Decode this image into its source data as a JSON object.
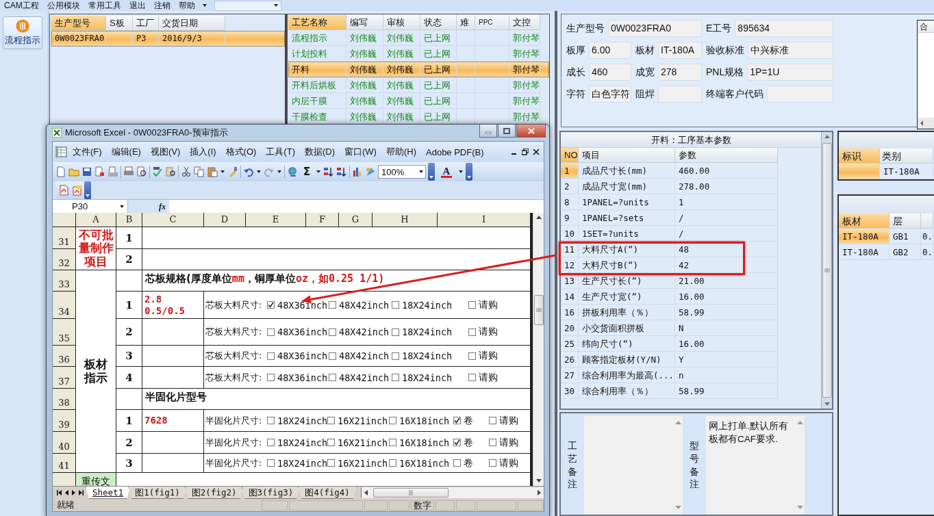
{
  "menu": [
    {
      "label": "CAM工程"
    },
    {
      "label": "公用模块"
    },
    {
      "label": "常用工具"
    },
    {
      "label": "退出"
    },
    {
      "label": "注销"
    },
    {
      "label": "帮助"
    }
  ],
  "sidebar": {
    "button": "流程指示"
  },
  "orders": {
    "columns": [
      {
        "label": "生产型号",
        "selected": true
      },
      {
        "label": "S板",
        "selected": false
      },
      {
        "label": "工厂",
        "selected": false
      },
      {
        "label": "交货日期",
        "selected": false
      }
    ],
    "rows": [
      {
        "model": "0W0023FRA0",
        "factory": "P3",
        "due": "2016/9/3",
        "selected": true
      }
    ]
  },
  "process": {
    "columns": [
      {
        "label": "工艺名称",
        "selected": true
      },
      {
        "label": "编写",
        "selected": false
      },
      {
        "label": "审核",
        "selected": false
      },
      {
        "label": "状态",
        "selected": false
      },
      {
        "label": "难",
        "selected": false
      },
      {
        "label": "PPC",
        "selected": false
      },
      {
        "label": "文控",
        "selected": false
      }
    ],
    "rows": [
      {
        "name": "流程指示",
        "writer": "刘伟巍",
        "reviewer": "刘伟巍",
        "status": "已上网",
        "control": "郭付琴",
        "selected": false
      },
      {
        "name": "计划投料",
        "writer": "刘伟巍",
        "reviewer": "刘伟巍",
        "status": "已上网",
        "control": "郭付琴",
        "selected": false
      },
      {
        "name": "开料",
        "writer": "刘伟巍",
        "reviewer": "刘伟巍",
        "status": "已上网",
        "control": "郭付琴",
        "selected": true
      },
      {
        "name": "开料后烘板",
        "writer": "刘伟巍",
        "reviewer": "刘伟巍",
        "status": "已上网",
        "control": "郭付琴",
        "selected": false
      },
      {
        "name": "内层干膜",
        "writer": "刘伟巍",
        "reviewer": "刘伟巍",
        "status": "已上网",
        "control": "郭付琴",
        "selected": false
      },
      {
        "name": "干膜检查",
        "writer": "刘伟巍",
        "reviewer": "刘伟巍",
        "status": "已上网",
        "control": "郭付琴",
        "selected": false
      }
    ]
  },
  "info": {
    "rows": [
      [
        {
          "label": "生产型号",
          "value": "0W0023FRA0"
        },
        {},
        {
          "label": "E工号",
          "value": "895634"
        }
      ],
      [
        {
          "label": "板厚",
          "value": "6.00"
        },
        {
          "label": "板材",
          "value": "IT-180A"
        },
        {
          "label": "验收标准",
          "value": "中兴标准"
        }
      ],
      [
        {
          "label": "成长",
          "value": "460"
        },
        {
          "label": "成宽",
          "value": "278"
        },
        {
          "label": "PNL规格",
          "value": "1P=1U"
        }
      ],
      [
        {
          "label": "字符",
          "value": "白色字符"
        },
        {
          "label": "阻焊"
        },
        {
          "label": "终端客户代码"
        }
      ]
    ],
    "merge_panel": {
      "header": "合"
    }
  },
  "params": {
    "title": "开料：工序基本参数",
    "columns": [
      {
        "label": "NO",
        "selected": true
      },
      {
        "label": "项目",
        "selected": false
      },
      {
        "label": "参数",
        "selected": false
      }
    ],
    "rows": [
      {
        "no": "1",
        "item": "成品尺寸长(mm)",
        "value": "460.00",
        "selected": true,
        "highlighted": false
      },
      {
        "no": "2",
        "item": "成品尺寸宽(mm)",
        "value": "278.00",
        "selected": false,
        "highlighted": false
      },
      {
        "no": "8",
        "item": "1PANEL=?units",
        "value": "1",
        "selected": false,
        "highlighted": false
      },
      {
        "no": "9",
        "item": "1PANEL=?sets",
        "value": "/",
        "selected": false,
        "highlighted": false
      },
      {
        "no": "10",
        "item": "1SET=?units",
        "value": "/",
        "selected": false,
        "highlighted": false
      },
      {
        "no": "11",
        "item": "大料尺寸A(“)",
        "value": "48",
        "selected": false,
        "highlighted": true
      },
      {
        "no": "12",
        "item": "大料尺寸B(“)",
        "value": "42",
        "selected": false,
        "highlighted": true
      },
      {
        "no": "13",
        "item": "生产尺寸长(“)",
        "value": "21.00",
        "selected": false,
        "highlighted": false
      },
      {
        "no": "14",
        "item": "生产尺寸宽(“)",
        "value": "16.00",
        "selected": false,
        "highlighted": false
      },
      {
        "no": "16",
        "item": "拼板利用率（％）",
        "value": "58.99",
        "selected": false,
        "highlighted": false
      },
      {
        "no": "20",
        "item": "小交货面积拼板",
        "value": "N",
        "selected": false,
        "highlighted": false
      },
      {
        "no": "25",
        "item": "纬向尺寸(“)",
        "value": "16.00",
        "selected": false,
        "highlighted": false
      },
      {
        "no": "26",
        "item": "顾客指定板材(Y/N)",
        "value": "Y",
        "selected": false,
        "highlighted": false
      },
      {
        "no": "27",
        "item": "综合利用率为最高(...",
        "value": "n",
        "selected": false,
        "highlighted": false
      },
      {
        "no": "30",
        "item": "综合利用率（％）",
        "value": "58.99",
        "selected": false,
        "highlighted": false
      }
    ]
  },
  "side_tables": [
    {
      "columns": [
        {
          "label": "标识",
          "selected": true
        },
        {
          "label": "类别",
          "selected": false
        }
      ],
      "rows": [
        {
          "cells": [
            "",
            "IT-180A"
          ],
          "selected": true
        }
      ]
    },
    {
      "columns": [
        {
          "label": "板材",
          "selected": true
        },
        {
          "label": "层",
          "selected": false
        },
        {
          "selected": false
        }
      ],
      "rows": [
        {
          "cells": [
            "IT-180A",
            "GB1",
            "0."
          ],
          "selected": true
        },
        {
          "cells": [
            "IT-180A",
            "GB2",
            "0."
          ],
          "selected": false
        }
      ]
    }
  ],
  "notes": [
    {
      "label": "工艺备注"
    },
    {
      "label": "型号备注",
      "text": "网上打单.默认所有板都有CAF要求."
    }
  ],
  "excel": {
    "title": "Microsoft Excel - 0W0023FRA0-预审指示",
    "menu": [
      "文件(F)",
      "编辑(E)",
      "视图(V)",
      "插入(I)",
      "格式(O)",
      "工具(T)",
      "数据(D)",
      "窗口(W)",
      "帮助(H)",
      "Adobe PDF(B)"
    ],
    "sum_symbol": "Σ",
    "zoom": "100%",
    "font_color_symbol": "A",
    "name_box": "P30",
    "fx": "fx",
    "columns": [
      "A",
      "B",
      "C",
      "D",
      "E",
      "F",
      "G",
      "H",
      "I"
    ],
    "sections": [
      {
        "label": "不可批量制作项目",
        "emphasis": true,
        "rows": [
          {
            "kind": "blank",
            "number": "31",
            "index": "1"
          },
          {
            "kind": "blank",
            "number": "32",
            "index": "2"
          }
        ]
      },
      {
        "label": "板材指示",
        "emphasis": false,
        "rows": [
          {
            "kind": "heading",
            "number": "33",
            "parts": [
              {
                "text": "芯板规格(厚度单位",
                "emphasis": false
              },
              {
                "text": "mm",
                "emphasis": true
              },
              {
                "text": "，铜厚单位",
                "emphasis": false
              },
              {
                "text": "oz，如0.25 1/1)",
                "emphasis": true
              }
            ]
          },
          {
            "kind": "options",
            "number": "34",
            "index": "1",
            "value": "2.8\n0.5/0.5",
            "label": "芯板大料尺寸:",
            "options": [
              {
                "text": "48X36inch",
                "checked": true
              },
              {
                "text": "48X42inch",
                "checked": false
              },
              {
                "text": "18X24inch",
                "checked": false
              },
              {
                "text": "请购",
                "checked": false
              }
            ]
          },
          {
            "kind": "options",
            "number": "35",
            "index": "2",
            "label": "芯板大料尺寸:",
            "options": [
              {
                "text": "48X36inch",
                "checked": false
              },
              {
                "text": "48X42inch",
                "checked": false
              },
              {
                "text": "18X24inch",
                "checked": false
              },
              {
                "text": "请购",
                "checked": false
              }
            ]
          },
          {
            "kind": "options",
            "number": "36",
            "index": "3",
            "label": "芯板大料尺寸:",
            "options": [
              {
                "text": "48X36inch",
                "checked": false
              },
              {
                "text": "48X42inch",
                "checked": false
              },
              {
                "text": "18X24inch",
                "checked": false
              },
              {
                "text": "请购",
                "checked": false
              }
            ]
          },
          {
            "kind": "options",
            "number": "37",
            "index": "4",
            "label": "芯板大料尺寸:",
            "options": [
              {
                "text": "48X36inch",
                "checked": false
              },
              {
                "text": "48X42inch",
                "checked": false
              },
              {
                "text": "18X24inch",
                "checked": false
              },
              {
                "text": "请购",
                "checked": false
              }
            ]
          },
          {
            "kind": "heading",
            "number": "38",
            "parts": [
              {
                "text": "半固化片型号",
                "emphasis": false
              }
            ]
          },
          {
            "kind": "options",
            "number": "39",
            "index": "1",
            "value": "7628",
            "label": "半固化片尺寸:",
            "options": [
              {
                "text": "18X24inch",
                "checked": false
              },
              {
                "text": "16X21inch",
                "checked": false
              },
              {
                "text": "16X18inch",
                "checked": false
              },
              {
                "text": "卷",
                "checked": true
              },
              {
                "text": "请购",
                "checked": false
              }
            ]
          },
          {
            "kind": "options",
            "number": "40",
            "index": "2",
            "label": "半固化片尺寸:",
            "options": [
              {
                "text": "18X24inch",
                "checked": false
              },
              {
                "text": "16X21inch",
                "checked": false
              },
              {
                "text": "16X18inch",
                "checked": false
              },
              {
                "text": "卷",
                "checked": true
              },
              {
                "text": "请购",
                "checked": false
              }
            ]
          },
          {
            "kind": "options",
            "number": "41",
            "index": "3",
            "label": "半固化片尺寸:",
            "options": [
              {
                "text": "18X24inch",
                "checked": false
              },
              {
                "text": "16X21inch",
                "checked": false
              },
              {
                "text": "16X18inch",
                "checked": false
              },
              {
                "text": "卷",
                "checked": false
              },
              {
                "text": "请购",
                "checked": false
              }
            ]
          }
        ]
      }
    ],
    "next_cell": "重传文",
    "sheets": [
      {
        "label": "Sheet1",
        "selected": true
      },
      {
        "label": "图1(fig1)",
        "selected": false
      },
      {
        "label": "图2(fig2)",
        "selected": false
      },
      {
        "label": "图3(fig3)",
        "selected": false
      },
      {
        "label": "图4(fig4)",
        "selected": false
      }
    ],
    "status": "就绪",
    "status_mode": "数字"
  }
}
